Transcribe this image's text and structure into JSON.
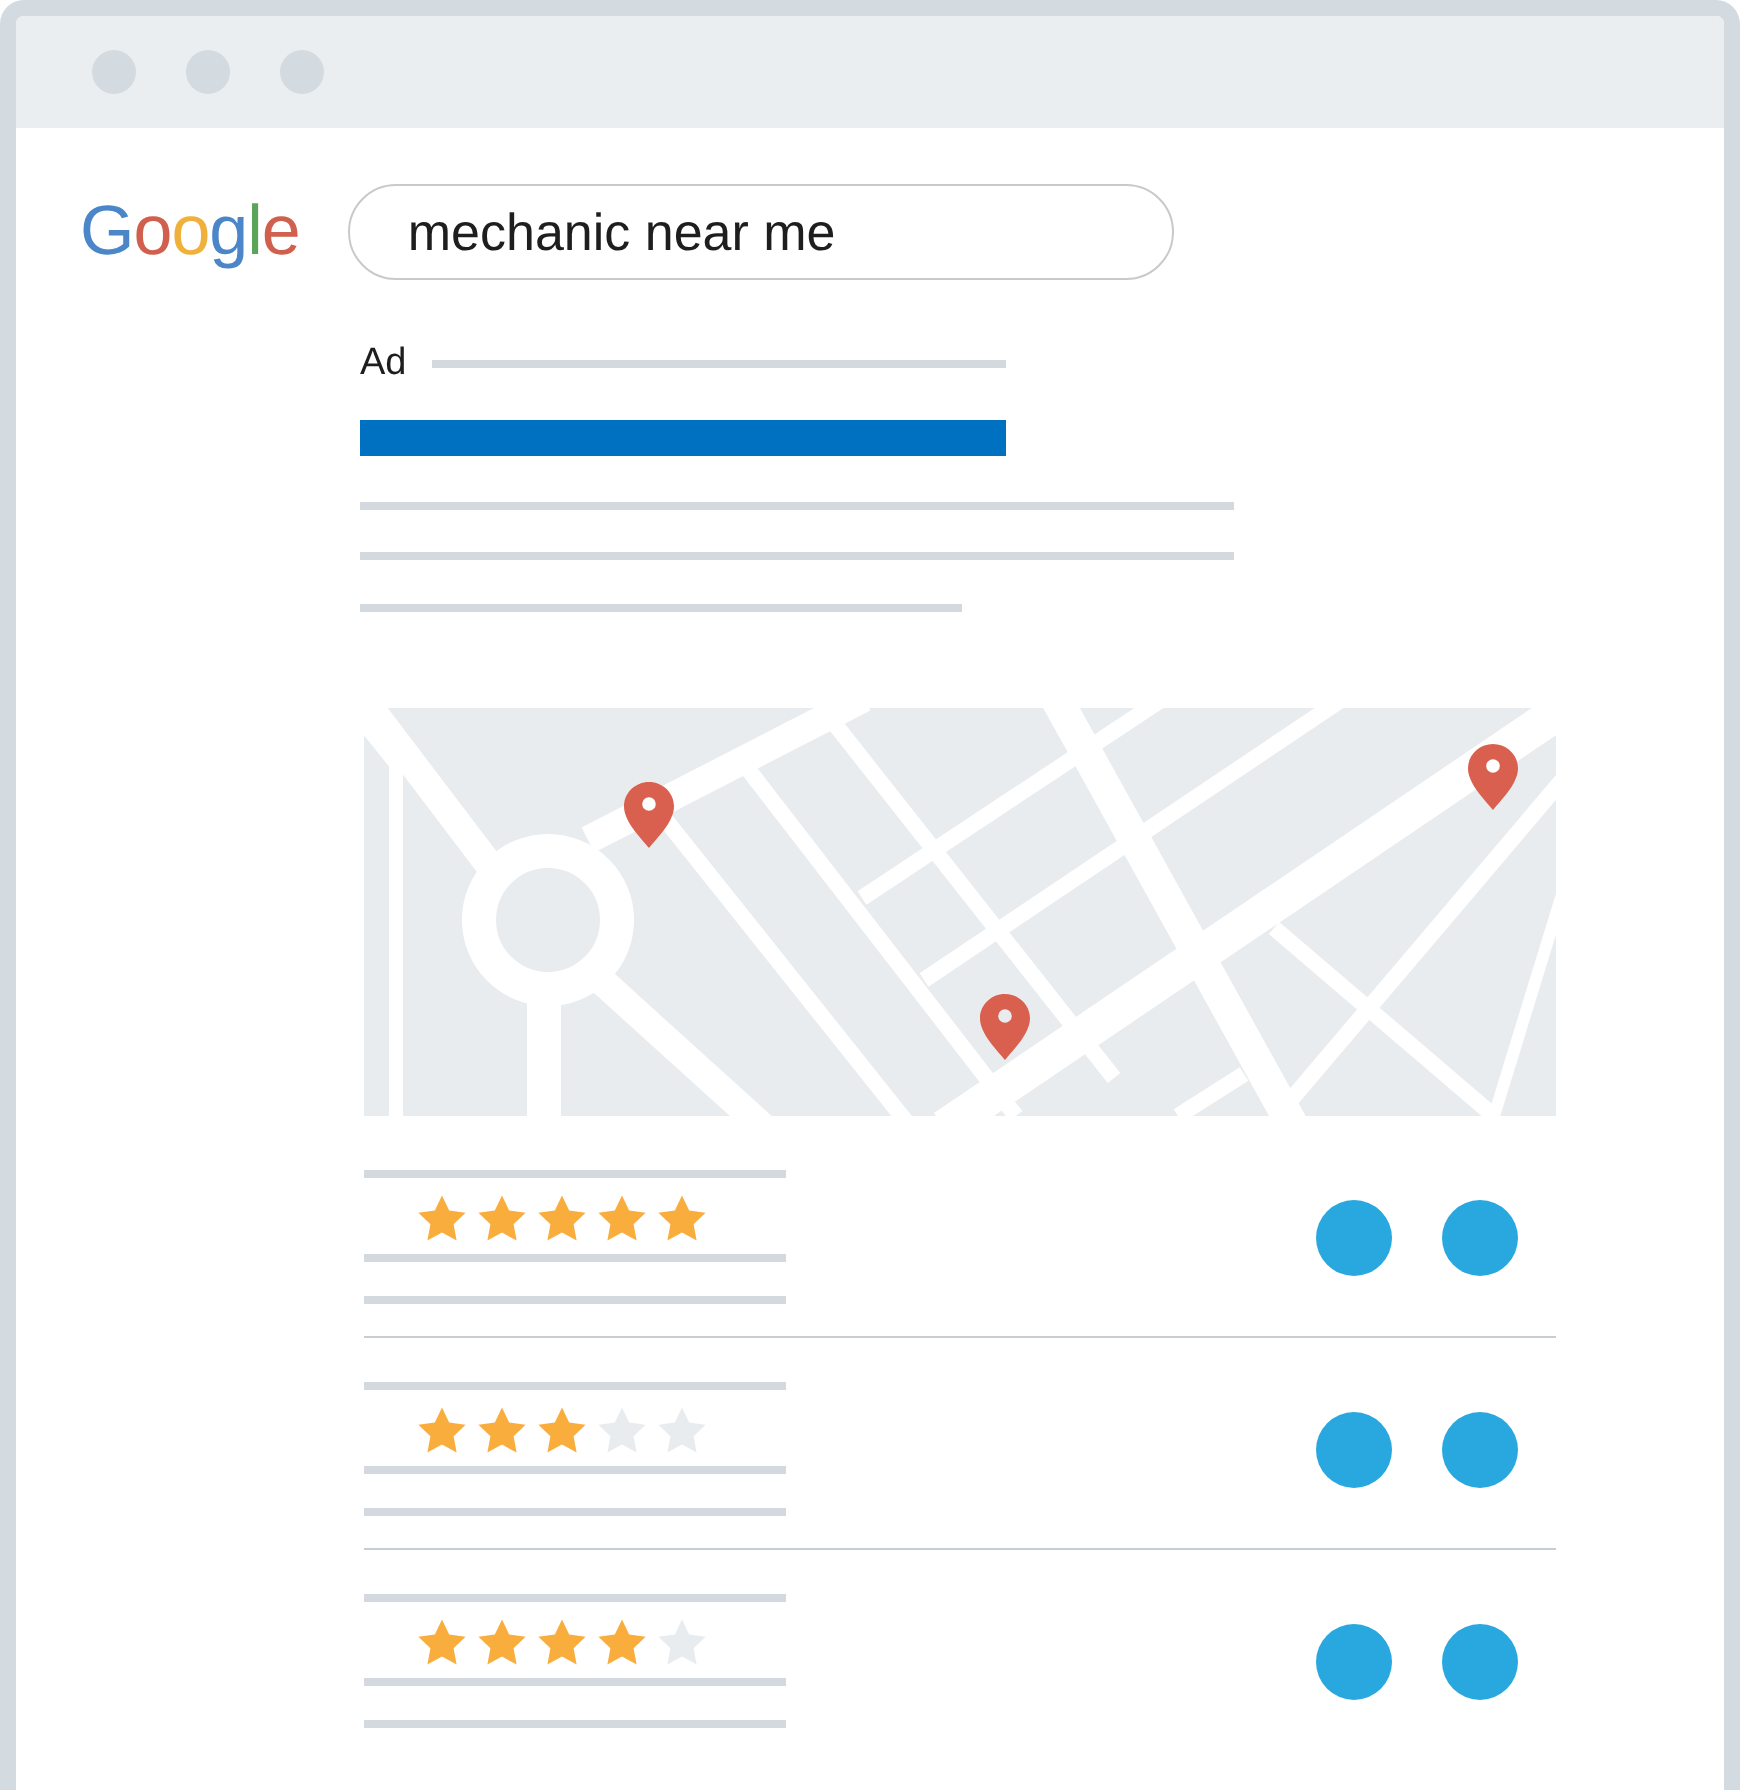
{
  "logo": "Google",
  "search": {
    "value": "mechanic near me"
  },
  "ad": {
    "label": "Ad"
  },
  "results": [
    {
      "stars": 5
    },
    {
      "stars": 3
    },
    {
      "stars": 4
    }
  ]
}
